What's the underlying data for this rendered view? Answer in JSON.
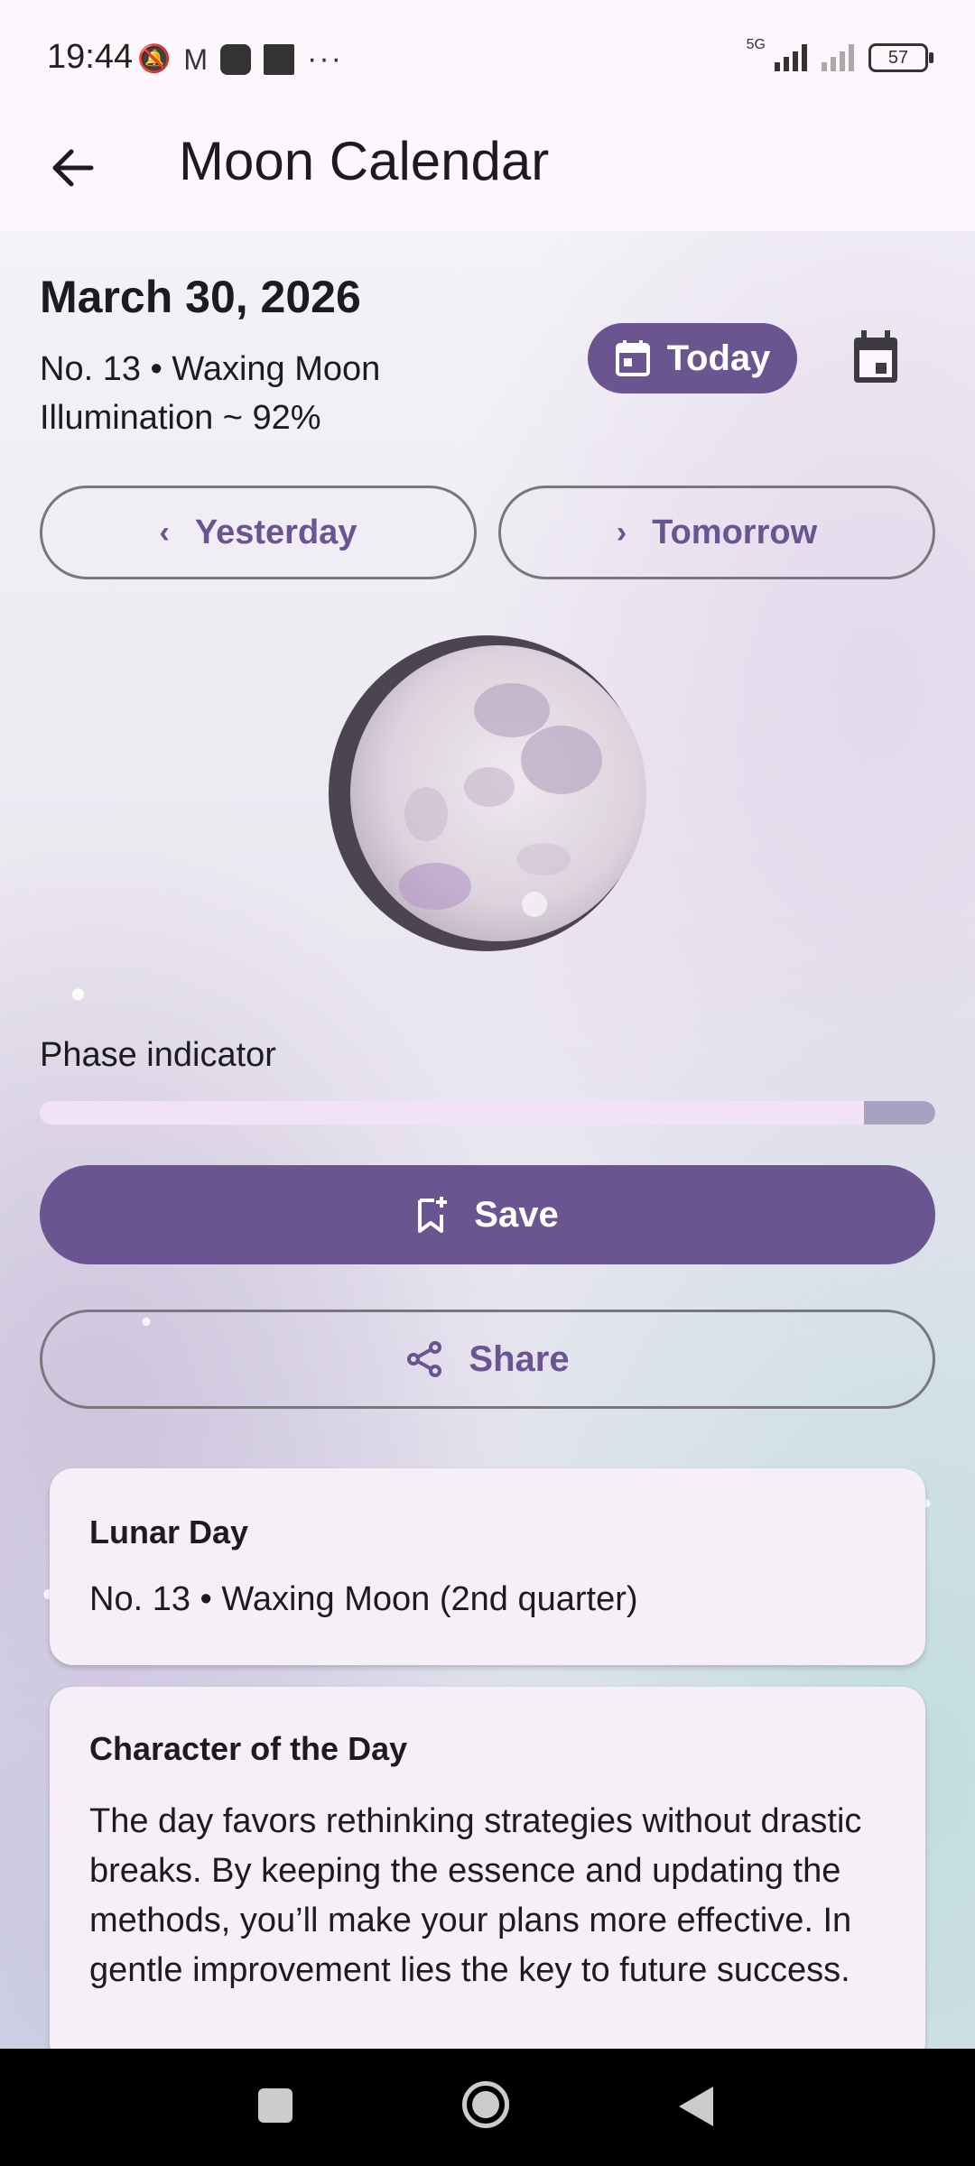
{
  "status_bar": {
    "time": "19:44",
    "network": "5G",
    "battery": "57"
  },
  "app_bar": {
    "title": "Moon Calendar",
    "back_icon": "arrow-left-icon"
  },
  "day_info": {
    "date": "March 30, 2026",
    "lunar_line": "No. 13 • Waxing Moon",
    "illumination": "Illumination ~ 92%"
  },
  "actions": {
    "today_label": "Today",
    "yesterday_label": "Yesterday",
    "tomorrow_label": "Tomorrow",
    "save_label": "Save",
    "share_label": "Share"
  },
  "phase": {
    "label": "Phase indicator",
    "level_percent": 92
  },
  "cards": {
    "lunar_day": {
      "title": "Lunar Day",
      "text": "No. 13 • Waxing Moon (2nd quarter)"
    },
    "character": {
      "title": "Character of the Day",
      "text": "The day favors rethinking strategies without drastic breaks. By keeping the essence and updating the methods, you’ll make your plans more effective. In gentle improvement lies the key to future success."
    }
  },
  "colors": {
    "primary": "#6a5590",
    "surface": "#fdf7fd",
    "card": "#f6eff7",
    "phase_track": "#f1e2f7",
    "phase_fill": "#a7a2c1"
  }
}
